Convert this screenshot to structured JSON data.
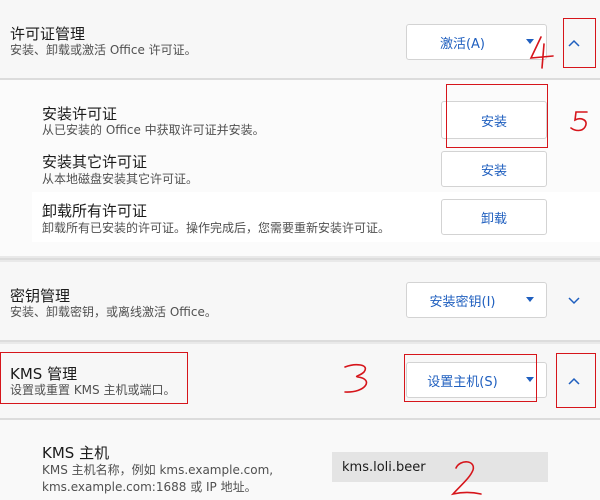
{
  "license": {
    "title": "许可证管理",
    "desc": "安装、卸载或激活 Office 许可证。",
    "dropdown": "激活(A)",
    "items": [
      {
        "title": "安装许可证",
        "desc": "从已安装的 Office 中获取许可证并安装。",
        "button": "安装"
      },
      {
        "title": "安装其它许可证",
        "desc": "从本地磁盘安装其它许可证。",
        "button": "安装"
      },
      {
        "title": "卸载所有许可证",
        "desc": "卸载所有已安装的许可证。操作完成后，您需要重新安装许可证。",
        "button": "卸载"
      }
    ]
  },
  "key": {
    "title": "密钥管理",
    "desc": "安装、卸载密钥，或离线激活 Office。",
    "dropdown": "安装密钥(I)"
  },
  "kms": {
    "title": "KMS 管理",
    "desc": "设置或重置 KMS 主机或端口。",
    "dropdown": "设置主机(S)",
    "host": {
      "title": "KMS 主机",
      "desc_line1": "KMS 主机名称，例如 kms.example.com,",
      "desc_line2": "kms.example.com:1688 或 IP 地址。",
      "value": "kms.loli.beer"
    }
  },
  "annotations": {
    "colors": {
      "mark": "#d6151b",
      "accent": "#1f5fbf"
    }
  }
}
